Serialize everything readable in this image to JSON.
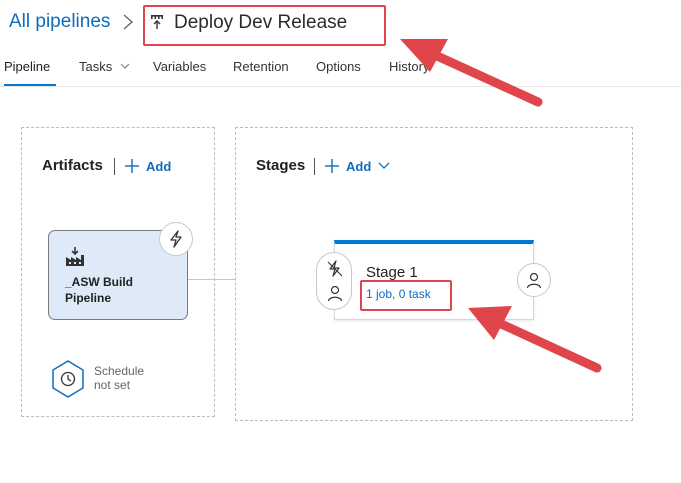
{
  "breadcrumb": {
    "root_label": "All pipelines",
    "separator_icon": "chevron-right-icon",
    "current_icon": "release-pipeline-icon",
    "title": "Deploy Dev Release"
  },
  "tabs": [
    {
      "label": "Pipeline",
      "active": true
    },
    {
      "label": "Tasks",
      "has_dropdown": true
    },
    {
      "label": "Variables"
    },
    {
      "label": "Retention"
    },
    {
      "label": "Options"
    },
    {
      "label": "History"
    }
  ],
  "artifacts": {
    "heading": "Artifacts",
    "add_label": "Add",
    "card": {
      "icon": "build-artifact-icon",
      "name": "_ASW Build Pipeline",
      "trigger_icon": "lightning-icon"
    },
    "schedule": {
      "icon": "clock-hexagon-icon",
      "line1": "Schedule",
      "line2": "not set"
    }
  },
  "stages": {
    "heading": "Stages",
    "add_label": "Add",
    "stage": {
      "name": "Stage 1",
      "summary": "1 job, 0 task",
      "pre_trigger_icon": "lightning-icon",
      "pre_approver_icon": "person-icon",
      "post_approver_icon": "person-icon"
    }
  },
  "colors": {
    "accent": "#0078d4",
    "link": "#0f6cbd",
    "annotation": "#e0454c",
    "artifact_card_bg": "#deeaf7"
  }
}
